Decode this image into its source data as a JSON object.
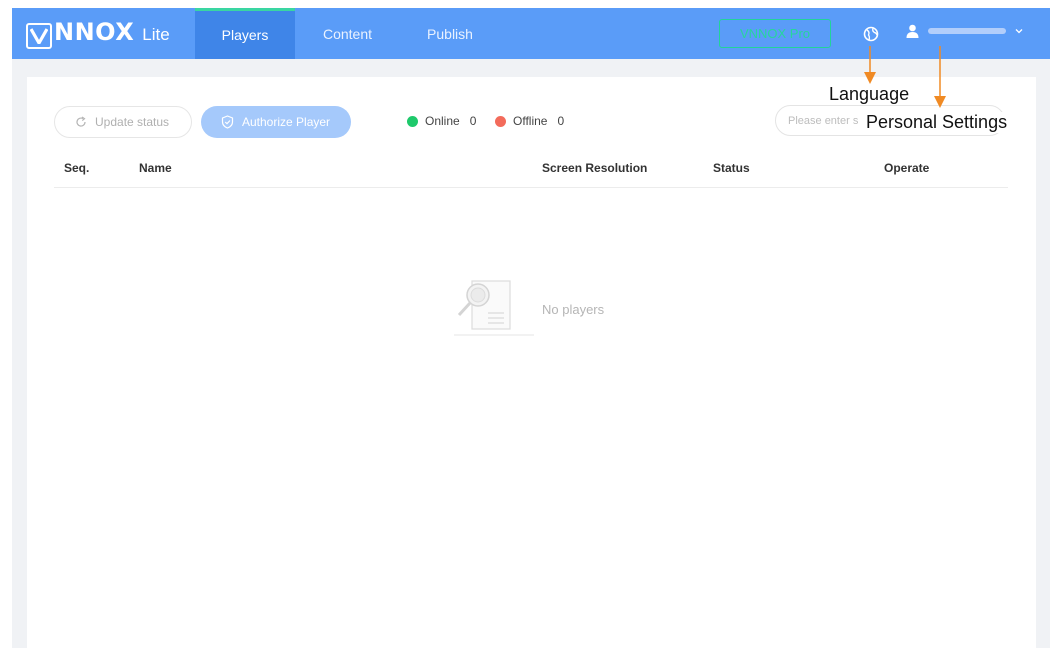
{
  "topbar": {
    "logo_main": "NNOX",
    "logo_sub": "Lite",
    "tabs": [
      {
        "label": "Players"
      },
      {
        "label": "Content"
      },
      {
        "label": "Publish"
      }
    ],
    "pro_button": "VNNOX Pro",
    "language_icon": "globe-icon",
    "user_icon": "user-icon"
  },
  "toolbar": {
    "update_status": "Update status",
    "authorize_player": "Authorize Player",
    "online_label": "Online",
    "online_count": "0",
    "offline_label": "Offline",
    "offline_count": "0",
    "search_placeholder": "Please enter s"
  },
  "table": {
    "columns": [
      "Seq.",
      "Name",
      "Screen Resolution",
      "Status",
      "Operate"
    ],
    "empty_text": "No players"
  },
  "annotations": {
    "language": "Language",
    "personal_settings": "Personal Settings"
  },
  "colors": {
    "topbar": "#5a9cf8",
    "active_tab": "#3f85e8",
    "pro_accent": "#22d39a",
    "online": "#1ec96b",
    "offline": "#f36b5b",
    "arrow": "#f08a24"
  }
}
